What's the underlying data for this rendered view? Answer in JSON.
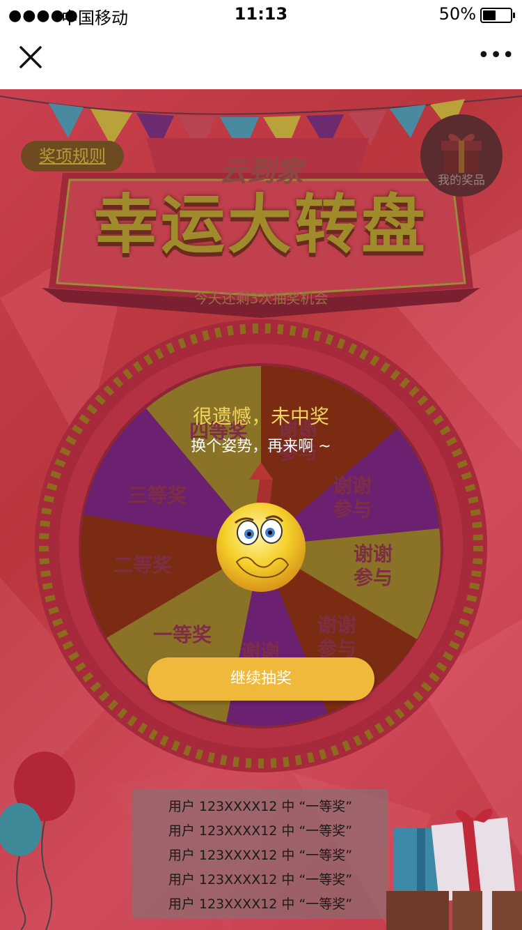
{
  "status_bar": {
    "signal": "●●●●●",
    "carrier": "中国移动",
    "time": "11:13",
    "battery": "50%"
  },
  "nav": {
    "more": "•••"
  },
  "page": {
    "rule_button": "奖项规则",
    "prize_button": "我的奖品",
    "app_name": "云到家",
    "title": "幸运大转盘",
    "chances": "今天还剩3次抽奖机会"
  },
  "wheel": {
    "segments": [
      "四等奖",
      "谢谢参与",
      "谢谢\n参与",
      "谢谢\n参与",
      "谢谢\n参与",
      "谢谢",
      "一等奖",
      "二等奖",
      "三等奖"
    ],
    "labels": {
      "s1": "四等奖",
      "s2a": "谢谢",
      "s2b": "参与",
      "s3a": "谢谢",
      "s3b": "参与",
      "s4a": "谢谢",
      "s4b": "参与",
      "s5a": "谢谢",
      "s5b": "参与",
      "s6": "谢谢",
      "s7": "一等奖",
      "s8": "二等奖",
      "s9": "三等奖"
    }
  },
  "result": {
    "title": "很遗憾，未中奖",
    "subtitle": "换个姿势，再来啊 ~",
    "continue_button": "继续抽奖"
  },
  "winners": [
    "用户 123XXXX12 中 “一等奖”",
    "用户 123XXXX12 中 “一等奖”",
    "用户 123XXXX12 中 “一等奖”",
    "用户 123XXXX12 中 “一等奖”",
    "用户 123XXXX12 中 “一等奖”"
  ]
}
